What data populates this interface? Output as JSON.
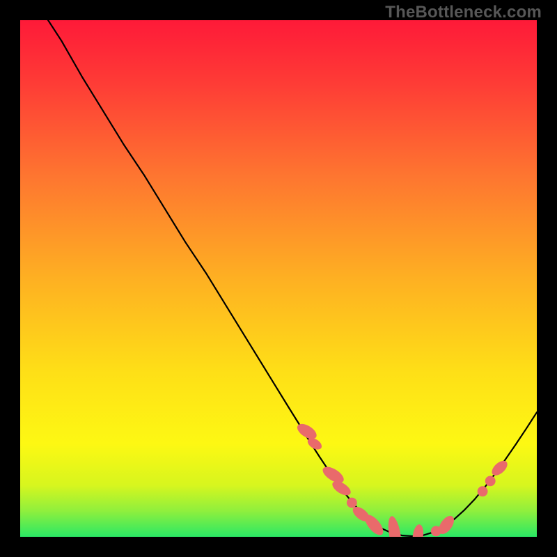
{
  "watermark": "TheBottleneck.com",
  "colors": {
    "gradient_top": "#fe1a38",
    "gradient_mid": "#fedf17",
    "gradient_bottom": "#2ae865",
    "curve_stroke": "#000000",
    "marker_fill": "#e96a6b",
    "background": "#000000"
  },
  "chart_data": {
    "type": "line",
    "title": "",
    "xlabel": "",
    "ylabel": "",
    "xlim": [
      0,
      100
    ],
    "ylim": [
      0,
      100
    ],
    "grid": false,
    "series": [
      {
        "name": "curve",
        "x": [
          5.4,
          8,
          12,
          16,
          20,
          24,
          28,
          32,
          36,
          40,
          44,
          48,
          52,
          54,
          56,
          58,
          60,
          62,
          64,
          66,
          68,
          70,
          72,
          74,
          76,
          78,
          80,
          82,
          84,
          86,
          88,
          90,
          92,
          94,
          96,
          98,
          100
        ],
        "y": [
          100,
          96,
          89,
          82.5,
          76,
          70,
          63.5,
          57,
          51,
          44.5,
          38,
          31.5,
          25,
          21.8,
          18.5,
          15.4,
          12.4,
          9.5,
          7,
          4.7,
          2.9,
          1.6,
          0.7,
          0.25,
          0.12,
          0.3,
          0.9,
          1.9,
          3.4,
          5.2,
          7.3,
          9.7,
          12.3,
          15.1,
          18,
          21,
          24.1
        ]
      }
    ],
    "markers": [
      {
        "kind": "blob",
        "x": 55.5,
        "y": 20.4,
        "rx": 1.1,
        "ry": 2.1,
        "rot": -58
      },
      {
        "kind": "blob",
        "x": 57.0,
        "y": 18.0,
        "rx": 0.9,
        "ry": 1.5,
        "rot": -58
      },
      {
        "kind": "blob",
        "x": 60.6,
        "y": 12.0,
        "rx": 1.1,
        "ry": 2.3,
        "rot": -58
      },
      {
        "kind": "blob",
        "x": 62.2,
        "y": 9.4,
        "rx": 1.0,
        "ry": 2.0,
        "rot": -58
      },
      {
        "kind": "dot",
        "x": 64.2,
        "y": 6.6,
        "r": 1.0
      },
      {
        "kind": "blob",
        "x": 66.0,
        "y": 4.4,
        "rx": 1.0,
        "ry": 1.9,
        "rot": -52
      },
      {
        "kind": "blob",
        "x": 68.5,
        "y": 2.3,
        "rx": 1.1,
        "ry": 2.4,
        "rot": -40
      },
      {
        "kind": "blob",
        "x": 72.5,
        "y": 0.55,
        "rx": 1.1,
        "ry": 3.5,
        "rot": -10
      },
      {
        "kind": "blob",
        "x": 77.0,
        "y": 0.22,
        "rx": 1.0,
        "ry": 2.2,
        "rot": 8
      },
      {
        "kind": "dot",
        "x": 80.5,
        "y": 1.1,
        "r": 1.0
      },
      {
        "kind": "blob",
        "x": 82.5,
        "y": 2.3,
        "rx": 1.1,
        "ry": 2.0,
        "rot": 35
      },
      {
        "kind": "dot",
        "x": 89.5,
        "y": 8.8,
        "r": 1.0
      },
      {
        "kind": "dot",
        "x": 91.0,
        "y": 10.8,
        "r": 1.0
      },
      {
        "kind": "blob",
        "x": 92.8,
        "y": 13.3,
        "rx": 1.0,
        "ry": 1.8,
        "rot": 48
      }
    ]
  }
}
